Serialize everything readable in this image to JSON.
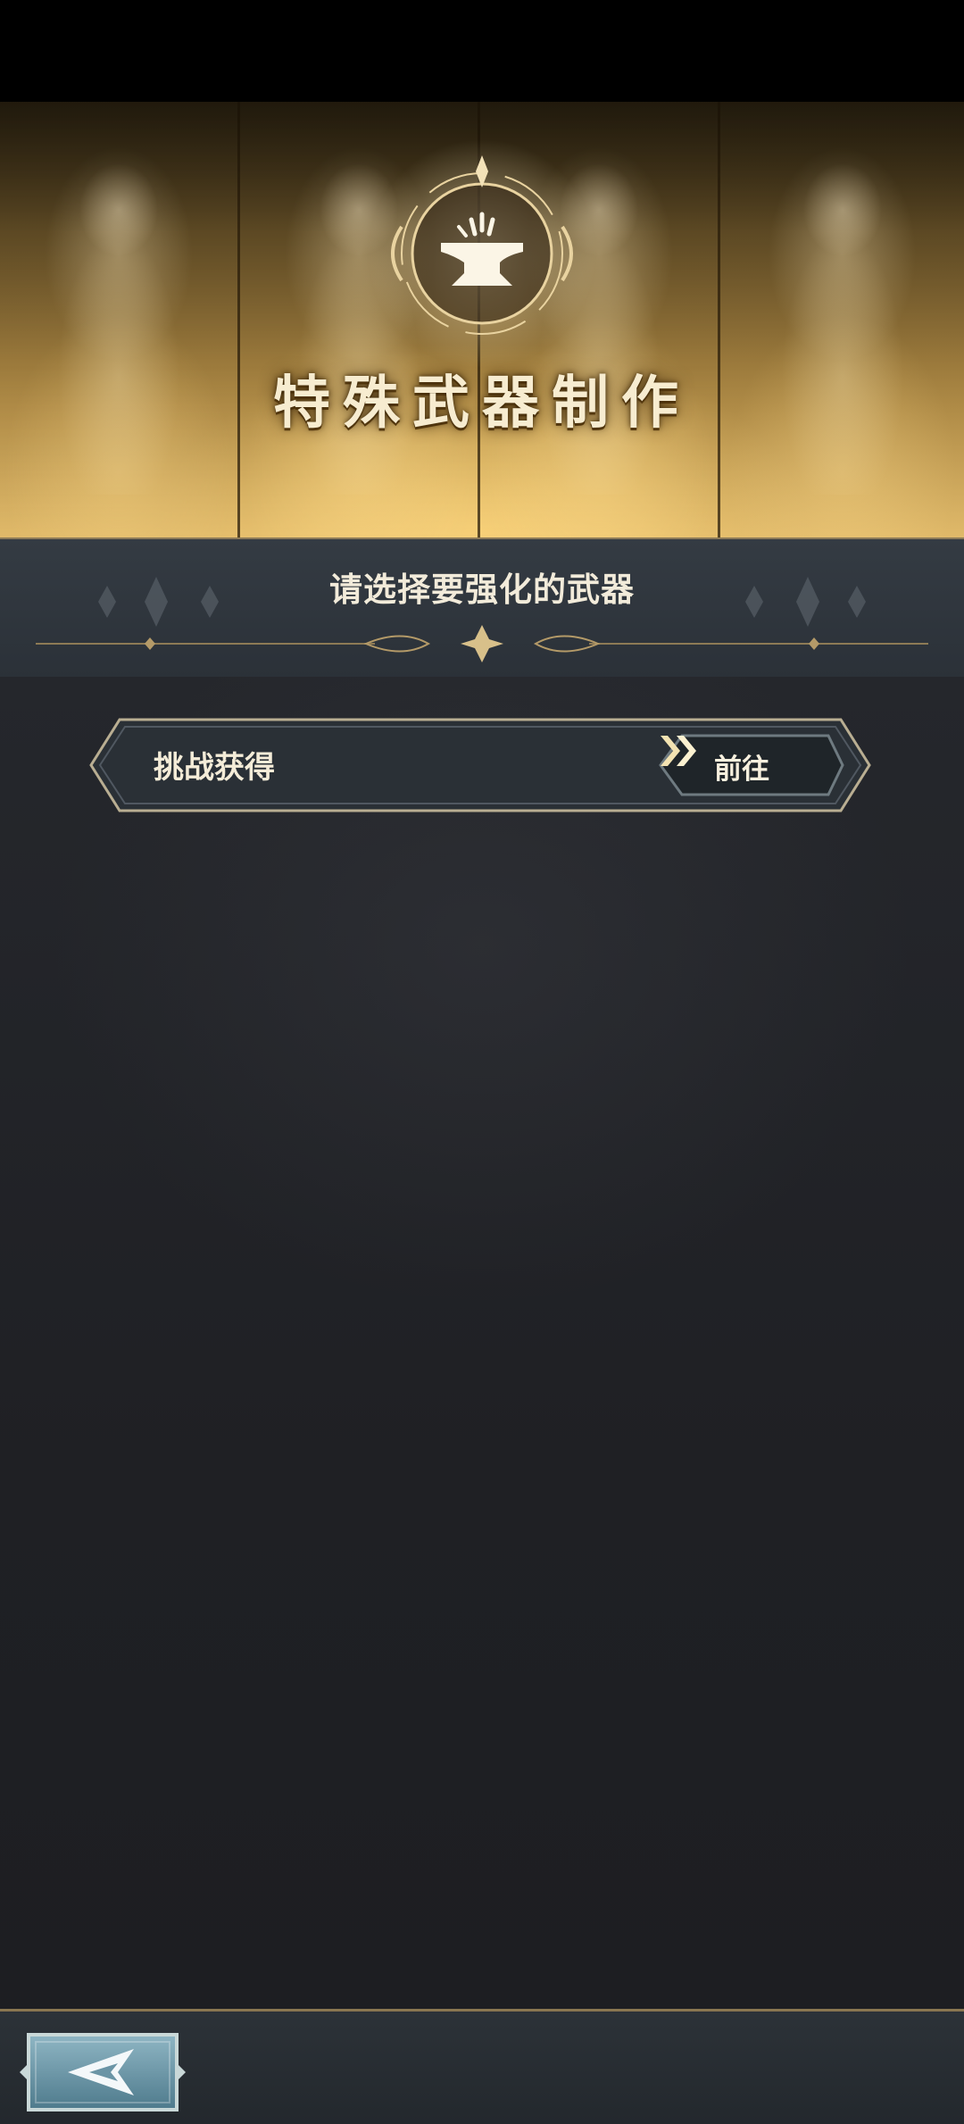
{
  "banner": {
    "title": "特殊武器制作",
    "emblem_icon": "anvil-icon"
  },
  "header": {
    "title": "请选择要强化的武器"
  },
  "options": [
    {
      "label": "挑战获得",
      "button_label": "前往",
      "button_icon": "double-chevron-right-icon"
    }
  ],
  "footer": {
    "back_icon": "back-arrow-icon"
  },
  "colors": {
    "accent_gold": "#d6ae5e",
    "panel_dark": "#1e1f23",
    "text_light": "#f2ead6"
  }
}
